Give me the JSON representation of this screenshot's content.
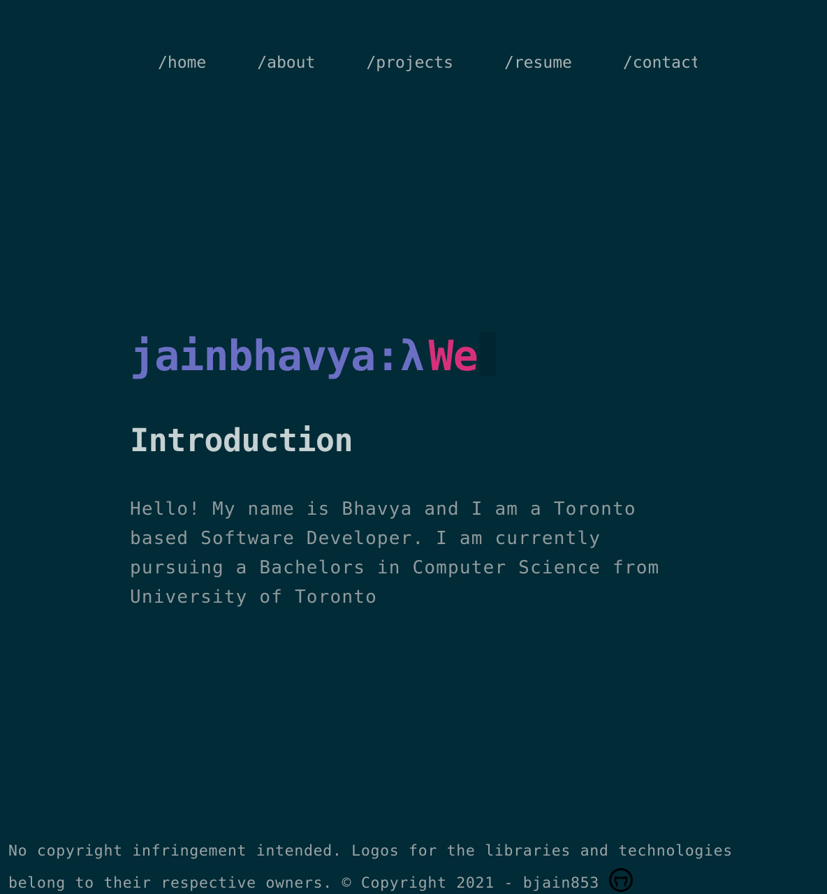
{
  "nav": {
    "items": [
      {
        "label": "/home"
      },
      {
        "label": "/about"
      },
      {
        "label": "/projects"
      },
      {
        "label": "/resume"
      },
      {
        "label": "/contact"
      }
    ]
  },
  "hero": {
    "prompt": "jainbhavya:λ",
    "typed": "We"
  },
  "intro": {
    "title": "Introduction",
    "body": "Hello! My name is Bhavya and I am a Toronto based Software Developer. I am currently pursuing a Bachelors in Computer Science from University of Toronto"
  },
  "footer": {
    "line1": "No copyright infringement intended. Logos for the libraries and technologies",
    "line2": "belong to their respective owners. © Copyright 2021 - bjain853",
    "icon": "github-icon"
  },
  "colors": {
    "background": "#012b37",
    "prompt": "#6b6fc4",
    "typed": "#d7307a",
    "heading": "#c5d1d2",
    "text": "#8f9a9c"
  }
}
